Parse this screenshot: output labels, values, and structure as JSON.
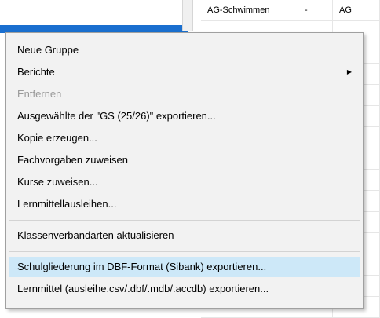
{
  "grid": {
    "rows": [
      {
        "cells": [
          "AG-Schwimmen",
          "-",
          "AG"
        ]
      },
      {
        "cells": [
          "",
          "",
          ""
        ]
      },
      {
        "cells": [
          "",
          "",
          ""
        ]
      },
      {
        "cells": [
          "",
          "",
          ""
        ]
      },
      {
        "cells": [
          "",
          "",
          ""
        ]
      },
      {
        "cells": [
          "",
          "",
          ""
        ]
      },
      {
        "cells": [
          "",
          "",
          ""
        ]
      },
      {
        "cells": [
          "",
          "",
          ""
        ]
      },
      {
        "cells": [
          "",
          "",
          ""
        ]
      },
      {
        "cells": [
          "",
          "",
          ""
        ]
      },
      {
        "cells": [
          "",
          "",
          ""
        ]
      },
      {
        "cells": [
          "",
          "",
          ""
        ]
      },
      {
        "cells": [
          "",
          "",
          ""
        ]
      },
      {
        "cells": [
          "",
          "",
          ""
        ]
      },
      {
        "cells": [
          "",
          "",
          ""
        ]
      }
    ]
  },
  "context_menu": {
    "items": [
      {
        "label": "Neue Gruppe"
      },
      {
        "label": "Berichte",
        "submenu": true
      },
      {
        "label": "Entfernen",
        "disabled": true
      },
      {
        "label": "Ausgewählte der \"GS (25/26)\" exportieren..."
      },
      {
        "label": "Kopie erzeugen..."
      },
      {
        "label": "Fachvorgaben zuweisen"
      },
      {
        "label": "Kurse zuweisen..."
      },
      {
        "label": "Lernmittellausleihen..."
      },
      {
        "label": "Klassenverbandarten aktualisieren"
      },
      {
        "label": "Schulgliederung im DBF-Format (Sibank) exportieren...",
        "highlighted": true
      },
      {
        "label": "Lernmittel (ausleihe.csv/.dbf/.mdb/.accdb) exportieren..."
      }
    ],
    "submenu_arrow_glyph": "▶"
  },
  "colors": {
    "selection_blue": "#1a6fcf",
    "menu_background": "#f2f2f2",
    "hover_highlight": "#cde8f8",
    "disabled_text": "#9a9a9a"
  }
}
